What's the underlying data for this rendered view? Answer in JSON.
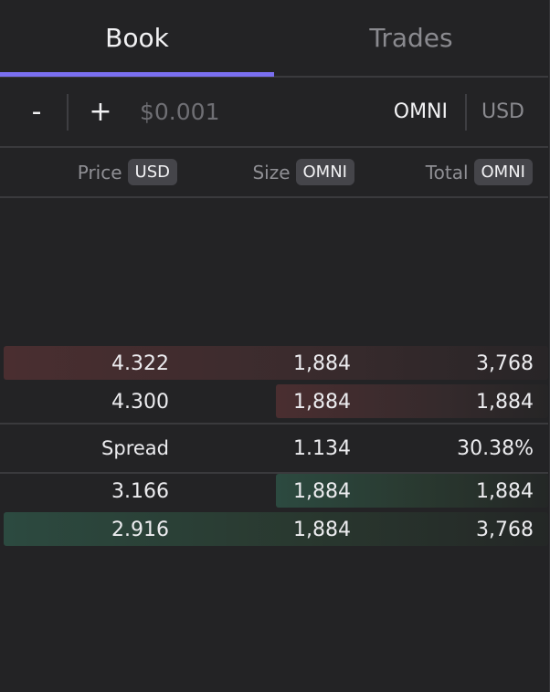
{
  "tabs": [
    {
      "label": "Book",
      "active": true
    },
    {
      "label": "Trades",
      "active": false
    }
  ],
  "controls": {
    "minus_label": "-",
    "plus_label": "+",
    "tick_size": "$0.001",
    "unit_options": [
      "OMNI",
      "USD"
    ],
    "selected_unit": "OMNI"
  },
  "columns": [
    {
      "label": "Price",
      "unit": "USD"
    },
    {
      "label": "Size",
      "unit": "OMNI"
    },
    {
      "label": "Total",
      "unit": "OMNI"
    }
  ],
  "asks": [
    {
      "price": "4.322",
      "size": "1,884",
      "total": "3,768",
      "depth_fraction": 1.0
    },
    {
      "price": "4.300",
      "size": "1,884",
      "total": "1,884",
      "depth_fraction": 0.5
    }
  ],
  "spread": {
    "label": "Spread",
    "value": "1.134",
    "percent": "30.38%"
  },
  "bids": [
    {
      "price": "3.166",
      "size": "1,884",
      "total": "1,884",
      "depth_fraction": 0.5
    },
    {
      "price": "2.916",
      "size": "1,884",
      "total": "3,768",
      "depth_fraction": 1.0
    }
  ],
  "colors": {
    "background": "#232325",
    "accent": "#7a6ff0",
    "ask_bar": "#4a2e30",
    "bid_bar": "#2c4a40"
  }
}
